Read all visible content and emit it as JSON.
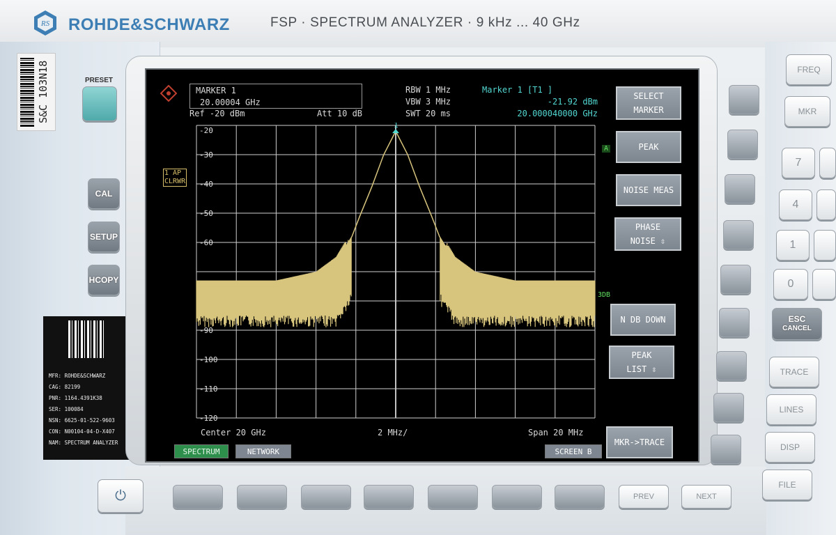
{
  "header": {
    "brand": "ROHDE&SCHWARZ",
    "model": "FSP · SPECTRUM ANALYZER · 9 kHz ... 40 GHz"
  },
  "serial_sticker": {
    "text": "S&C 103N18"
  },
  "front_panel": {
    "preset_label": "PRESET",
    "cal": "CAL",
    "setup": "SETUP",
    "hcopy": "HCOPY"
  },
  "nameplate": {
    "lines": [
      "MFR: ROHDE&SCHWARZ",
      "CAG: 82199",
      "PNR: 1164.4391K38",
      "SER: 100084",
      "NSN: 6625-01-522-9603",
      "CON: N00104-04-D-X407",
      "NAM:  SPECTRUM ANALYZER"
    ]
  },
  "screen": {
    "marker_box": {
      "title": "MARKER 1",
      "value": "20.00004 GHz"
    },
    "ref_level": "Ref -20 dBm",
    "attenuation": "Att  10 dB",
    "rbw": "RBW 1 MHz",
    "vbw": "VBW 3 MHz",
    "swt": "SWT 20 ms",
    "marker_label": "Marker 1 [T1 ]",
    "marker_level": "-21.92 dBm",
    "marker_freq": "20.000040000 GHz",
    "trace_mode": [
      "1 AP",
      "CLRWR"
    ],
    "side_flag_a": "A",
    "side_flag_3db": "3DB",
    "center": "Center 20 GHz",
    "div": "2 MHz/",
    "span": "Span 20 MHz",
    "marker_num": "1",
    "tabs": {
      "spectrum": "SPECTRUM",
      "network": "NETWORK",
      "screen_b": "SCREEN B"
    },
    "softkeys": [
      [
        "SELECT",
        "MARKER"
      ],
      [
        "PEAK"
      ],
      [
        "NOISE MEAS"
      ],
      [
        "PHASE",
        "NOISE ⇳"
      ],
      [
        "N DB DOWN"
      ],
      [
        "PEAK",
        "LIST ⇳"
      ],
      [
        "MKR->TRACE"
      ]
    ]
  },
  "chart_data": {
    "type": "line",
    "title": "",
    "xlabel": "",
    "ylabel": "",
    "x_unit": "MHz offset",
    "xlim": [
      -10,
      10
    ],
    "ylim": [
      -120,
      -20
    ],
    "ytick_labels": [
      "-20",
      "-30",
      "-40",
      "-50",
      "-60",
      "-90",
      "-100",
      "-110",
      "-120"
    ],
    "x_center_ghz": 20,
    "x_per_div_mhz": 2,
    "series": [
      {
        "x": [
          -10,
          -6,
          -4,
          -3,
          -2.2,
          -1.8,
          -1.2,
          -0.6,
          0,
          0.6,
          1.2,
          1.8,
          2.2,
          3,
          4,
          6,
          10
        ],
        "y": [
          -75,
          -75,
          -72,
          -67,
          -58,
          -51,
          -41,
          -30,
          -22,
          -30,
          -41,
          -51,
          -58,
          -67,
          -72,
          -75,
          -75
        ]
      }
    ],
    "noise_floor_band": [
      -85,
      -60
    ],
    "peak": {
      "x": 0,
      "y": -21.92
    },
    "grid": true,
    "color": "#d7c47d"
  },
  "right_keys": {
    "freq": "FREQ",
    "mkr": "MKR",
    "digits": [
      "7",
      "4",
      "1",
      "0"
    ],
    "esc": "ESC",
    "cancel": "CANCEL",
    "trace": "TRACE",
    "lines": "LINES",
    "disp": "DISP",
    "file": "FILE"
  },
  "bottom_keys": {
    "prev": "PREV",
    "next": "NEXT"
  }
}
